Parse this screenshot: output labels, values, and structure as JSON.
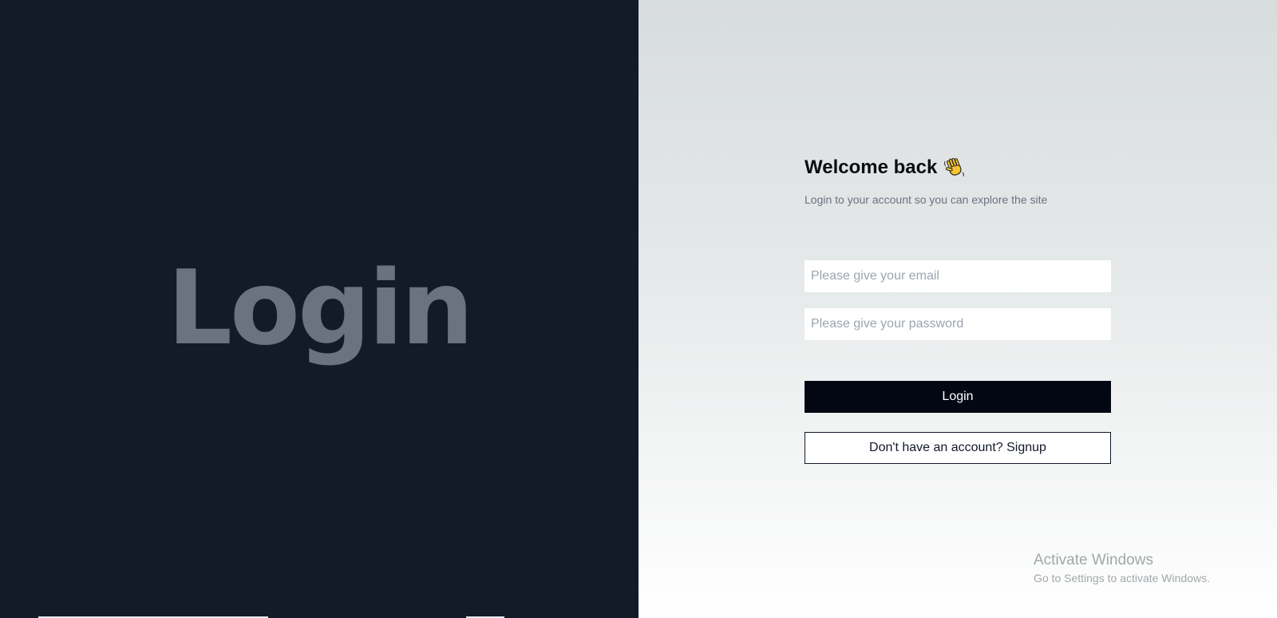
{
  "colors": {
    "left_panel_bg": "#131a28",
    "hero_text": "#6b7280",
    "primary_button_bg": "#030712",
    "primary_button_text": "#ffffff"
  },
  "left": {
    "hero_text": "Login"
  },
  "form": {
    "title": "Welcome back",
    "title_icon": "waving-hand-icon",
    "subtitle": "Login to your account so you can explore the site",
    "email_placeholder": "Please give your email",
    "email_value": "",
    "password_placeholder": "Please give your password",
    "password_value": "",
    "login_label": "Login",
    "signup_label": "Don't have an account? Signup"
  },
  "watermark": {
    "title": "Activate Windows",
    "subtitle": "Go to Settings to activate Windows."
  }
}
